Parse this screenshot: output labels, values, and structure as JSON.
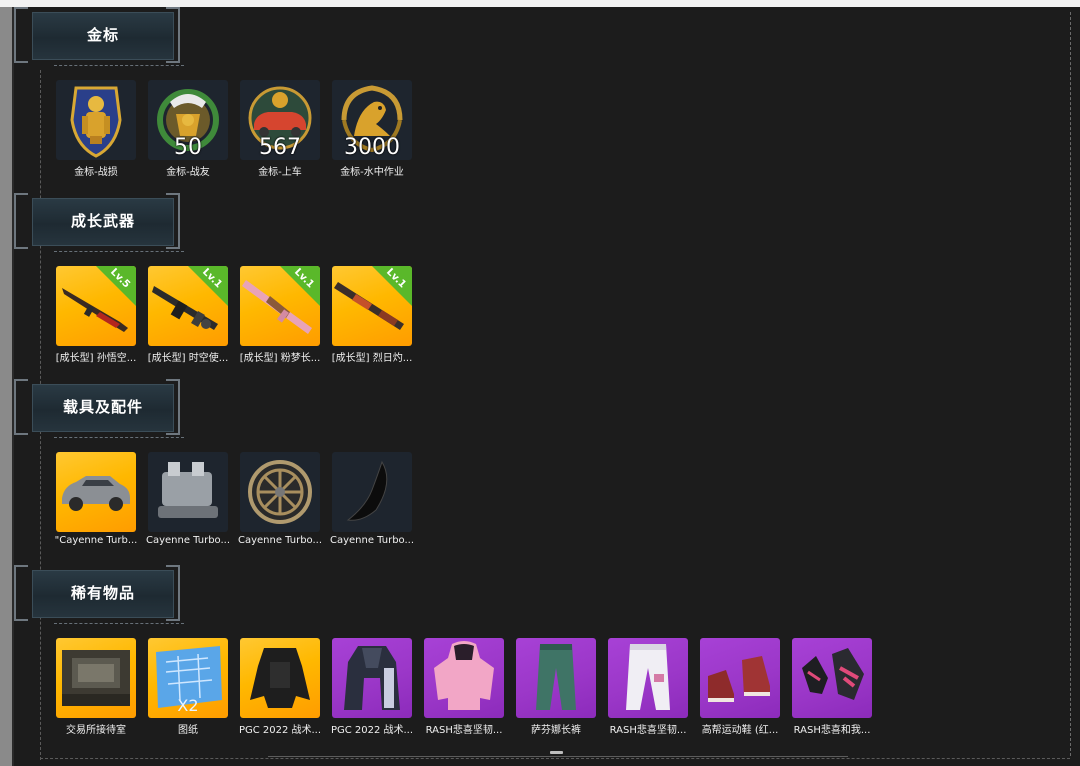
{
  "sections": [
    {
      "title": "金标",
      "items": [
        {
          "label": "金标-战损",
          "count": "",
          "bg": "dark",
          "icon": "gold-soldier-badge-icon"
        },
        {
          "label": "金标-战友",
          "count": "50",
          "bg": "dark",
          "icon": "gold-eagle-badge-icon"
        },
        {
          "label": "金标-上车",
          "count": "567",
          "bg": "dark",
          "icon": "gold-car-badge-icon"
        },
        {
          "label": "金标-水中作业",
          "count": "3000",
          "bg": "dark",
          "icon": "gold-seal-badge-icon"
        }
      ]
    },
    {
      "title": "成长武器",
      "items": [
        {
          "label": "[成长型] 孙悟空...",
          "level": "Lv.5",
          "bg": "gold",
          "icon": "rifle-red-icon"
        },
        {
          "label": "[成长型] 时空使...",
          "level": "Lv.1",
          "bg": "gold",
          "icon": "smg-dark-icon"
        },
        {
          "label": "[成长型] 粉梦长...",
          "level": "Lv.1",
          "bg": "gold",
          "icon": "rifle-pink-icon"
        },
        {
          "label": "[成长型] 烈日灼...",
          "level": "Lv.1",
          "bg": "gold",
          "icon": "rifle-orange-icon"
        }
      ]
    },
    {
      "title": "载具及配件",
      "items": [
        {
          "label": "\"Cayenne Turb...",
          "bg": "gold",
          "icon": "suv-car-icon"
        },
        {
          "label": "Cayenne Turbo...",
          "bg": "dark",
          "icon": "engine-part-icon"
        },
        {
          "label": "Cayenne Turbo...",
          "bg": "dark",
          "icon": "wheel-rim-icon"
        },
        {
          "label": "Cayenne Turbo...",
          "bg": "dark",
          "icon": "car-fender-icon"
        }
      ]
    },
    {
      "title": "稀有物品",
      "items": [
        {
          "label": "交易所接待室",
          "bg": "gold",
          "icon": "room-interior-icon"
        },
        {
          "label": "图纸",
          "count": "X2",
          "bg": "gold",
          "icon": "blueprint-icon"
        },
        {
          "label": "PGC 2022 战术...",
          "bg": "gold",
          "icon": "tactical-vest-icon"
        },
        {
          "label": "PGC 2022 战术...",
          "bg": "purple",
          "icon": "tactical-coat-icon"
        },
        {
          "label": "RASH悲喜坚韧...",
          "bg": "purple",
          "icon": "pink-hoodie-icon"
        },
        {
          "label": "萨芬娜长裤",
          "bg": "purple",
          "icon": "green-pants-icon"
        },
        {
          "label": "RASH悲喜坚韧...",
          "bg": "purple",
          "icon": "white-pants-icon"
        },
        {
          "label": "高帮运动鞋 (红...",
          "bg": "purple",
          "icon": "red-sneakers-icon"
        },
        {
          "label": "RASH悲喜和我...",
          "bg": "purple",
          "icon": "gloves-icon"
        }
      ]
    }
  ],
  "colors": {
    "tile_gold": "#ffb800",
    "tile_purple": "#9b37c8",
    "tile_dark": "#1e252e",
    "level_badge": "#5ab82a",
    "background": "#1c1c1c"
  }
}
